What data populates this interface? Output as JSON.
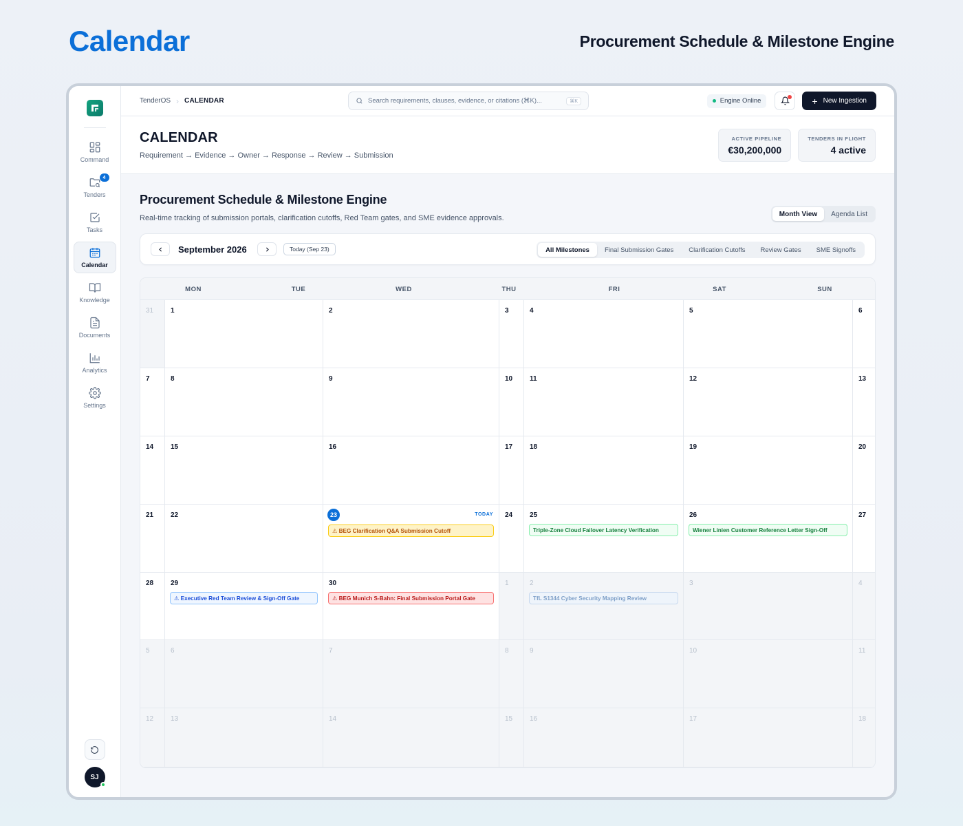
{
  "page": {
    "title": "Calendar",
    "subtitle": "Procurement Schedule & Milestone Engine"
  },
  "sidebar": {
    "items": [
      {
        "label": "Command",
        "icon": "grid-icon",
        "active": false
      },
      {
        "label": "Tenders",
        "icon": "folder-search-icon",
        "active": false,
        "badge": "4"
      },
      {
        "label": "Tasks",
        "icon": "checkbox-icon",
        "active": false
      },
      {
        "label": "Calendar",
        "icon": "calendar-icon",
        "active": true
      },
      {
        "label": "Knowledge",
        "icon": "book-icon",
        "active": false
      },
      {
        "label": "Documents",
        "icon": "document-icon",
        "active": false
      },
      {
        "label": "Analytics",
        "icon": "bar-chart-icon",
        "active": false
      },
      {
        "label": "Settings",
        "icon": "gear-icon",
        "active": false
      }
    ],
    "avatar_initials": "SJ"
  },
  "topbar": {
    "breadcrumb_root": "TenderOS",
    "breadcrumb_current": "CALENDAR",
    "search_placeholder": "Search requirements, clauses, evidence, or citations (⌘K)...",
    "search_shortcut": "⌘K",
    "engine_status": "Engine Online",
    "new_button": "New Ingestion"
  },
  "header": {
    "title": "CALENDAR",
    "flow": "Requirement → Evidence → Owner → Response → Review → Submission",
    "stats": [
      {
        "label": "ACTIVE PIPELINE",
        "value": "€30,200,000"
      },
      {
        "label": "TENDERS IN FLIGHT",
        "value": "4 active"
      }
    ]
  },
  "section": {
    "title": "Procurement Schedule & Milestone Engine",
    "description": "Real-time tracking of submission portals, clarification cutoffs, Red Team gates, and SME evidence approvals.",
    "views": [
      "Month View",
      "Agenda List"
    ],
    "active_view": "Month View"
  },
  "calendar": {
    "month": "September 2026",
    "today_button": "Today (Sep 23)",
    "today_tag": "TODAY",
    "filters": [
      "All Milestones",
      "Final Submission Gates",
      "Clarification Cutoffs",
      "Review Gates",
      "SME Signoffs"
    ],
    "active_filter": "All Milestones",
    "weekdays": [
      "MON",
      "TUE",
      "WED",
      "THU",
      "FRI",
      "SAT",
      "SUN"
    ],
    "weeks": [
      [
        {
          "d": "31",
          "m": true
        },
        {
          "d": "1"
        },
        {
          "d": "2"
        },
        {
          "d": "3"
        },
        {
          "d": "4"
        },
        {
          "d": "5"
        },
        {
          "d": "6"
        }
      ],
      [
        {
          "d": "7"
        },
        {
          "d": "8"
        },
        {
          "d": "9"
        },
        {
          "d": "10"
        },
        {
          "d": "11"
        },
        {
          "d": "12"
        },
        {
          "d": "13"
        }
      ],
      [
        {
          "d": "14"
        },
        {
          "d": "15"
        },
        {
          "d": "16"
        },
        {
          "d": "17"
        },
        {
          "d": "18"
        },
        {
          "d": "19"
        },
        {
          "d": "20"
        }
      ],
      [
        {
          "d": "21"
        },
        {
          "d": "22"
        },
        {
          "d": "23",
          "today": true,
          "event": {
            "text": "⚠ BEG Clarification Q&A Submission Cutoff",
            "style": "ev-yellow"
          }
        },
        {
          "d": "24"
        },
        {
          "d": "25",
          "event": {
            "text": "Triple-Zone Cloud Failover Latency Verification",
            "style": "ev-green"
          }
        },
        {
          "d": "26",
          "event": {
            "text": "Wiener Linien Customer Reference Letter Sign-Off",
            "style": "ev-green"
          }
        },
        {
          "d": "27"
        }
      ],
      [
        {
          "d": "28"
        },
        {
          "d": "29",
          "event": {
            "text": "⚠ Executive Red Team Review & Sign-Off Gate",
            "style": "ev-blue"
          }
        },
        {
          "d": "30",
          "event": {
            "text": "⚠ BEG Munich S-Bahn: Final Submission Portal Gate",
            "style": "ev-red"
          }
        },
        {
          "d": "1",
          "m": true
        },
        {
          "d": "2",
          "m": true,
          "event": {
            "text": "TfL S1344 Cyber Security Mapping Review",
            "style": "ev-faded"
          }
        },
        {
          "d": "3",
          "m": true
        },
        {
          "d": "4",
          "m": true
        }
      ],
      [
        {
          "d": "5",
          "m": true
        },
        {
          "d": "6",
          "m": true
        },
        {
          "d": "7",
          "m": true
        },
        {
          "d": "8",
          "m": true
        },
        {
          "d": "9",
          "m": true
        },
        {
          "d": "10",
          "m": true
        },
        {
          "d": "11",
          "m": true
        }
      ],
      [
        {
          "d": "12",
          "m": true
        },
        {
          "d": "13",
          "m": true
        },
        {
          "d": "14",
          "m": true
        },
        {
          "d": "15",
          "m": true
        },
        {
          "d": "16",
          "m": true
        },
        {
          "d": "17",
          "m": true
        },
        {
          "d": "18",
          "m": true
        }
      ]
    ]
  },
  "colors": {
    "accent": "#0b6fd8",
    "logo": "#14a37f",
    "online": "#10b981",
    "alert": "#ef4444"
  }
}
